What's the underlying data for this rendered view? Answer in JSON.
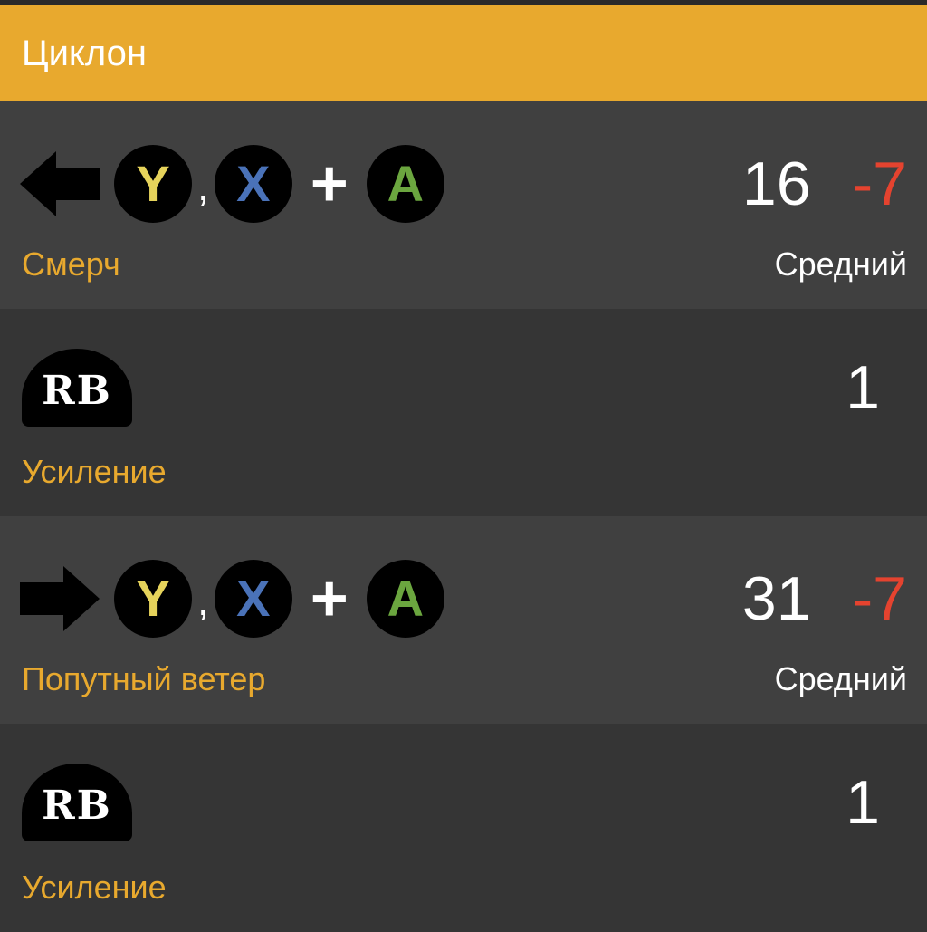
{
  "header": {
    "title": "Циклон"
  },
  "buttons": {
    "y": {
      "label": "Y",
      "color": "#E6D35B"
    },
    "x": {
      "label": "X",
      "color": "#4A72B8"
    },
    "a": {
      "label": "A",
      "color": "#6BA63F"
    },
    "rb": {
      "label": "RB"
    }
  },
  "separator": ",",
  "plus": "+",
  "moves": [
    {
      "direction": "back",
      "name": "Смерч",
      "damage": "16",
      "advantage": "-7",
      "level": "Средний"
    },
    {
      "name": "Усиление",
      "value": "1"
    },
    {
      "direction": "forward",
      "name": "Попутный ветер",
      "damage": "31",
      "advantage": "-7",
      "level": "Средний"
    },
    {
      "name": "Усиление",
      "value": "1"
    }
  ],
  "colors": {
    "accent": "#E8A92E",
    "negative": "#E5432F",
    "row_light": "#404040",
    "row_dark": "#353535"
  }
}
